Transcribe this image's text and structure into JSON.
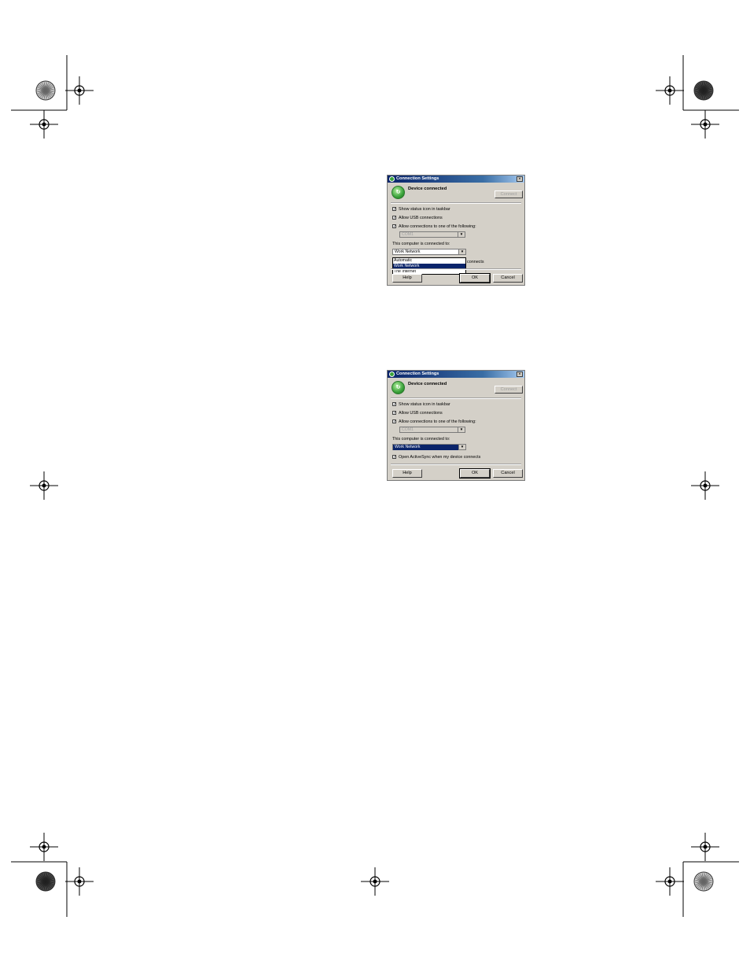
{
  "dialogs": [
    {
      "title": "Connection Settings",
      "close": "×",
      "device_status": "Device connected",
      "connect_button": "Connect",
      "show_status_icon": "Show status icon in taskbar",
      "allow_usb": "Allow USB connections",
      "allow_connections": "Allow connections to one of the following:",
      "port_value": "COM1",
      "connected_to_label": "This computer is connected to:",
      "connected_to_value": "Work Network",
      "dropdown_options": [
        "Automatic",
        "Work Network",
        "The Internet"
      ],
      "dropdown_selected": "Work Network",
      "open_activesync_partial": "connects",
      "help_button": "Help",
      "ok_button": "OK",
      "cancel_button": "Cancel"
    },
    {
      "title": "Connection Settings",
      "close": "×",
      "device_status": "Device connected",
      "connect_button": "Connect",
      "show_status_icon": "Show status icon in taskbar",
      "allow_usb": "Allow USB connections",
      "allow_connections": "Allow connections to one of the following:",
      "port_value": "COM1",
      "connected_to_label": "This computer is connected to:",
      "connected_to_value": "Work Network",
      "open_activesync": "Open ActiveSync when my device connects",
      "help_button": "Help",
      "ok_button": "OK",
      "cancel_button": "Cancel"
    }
  ],
  "icons": {
    "title_icon": "activesync-icon",
    "device_icon": "sync-arrows-icon",
    "registration_mark": "crosshair-registration-icon",
    "color_wheel": "starburst-registration-icon",
    "checkmark": "✓",
    "dropdown_arrow": "▼"
  }
}
